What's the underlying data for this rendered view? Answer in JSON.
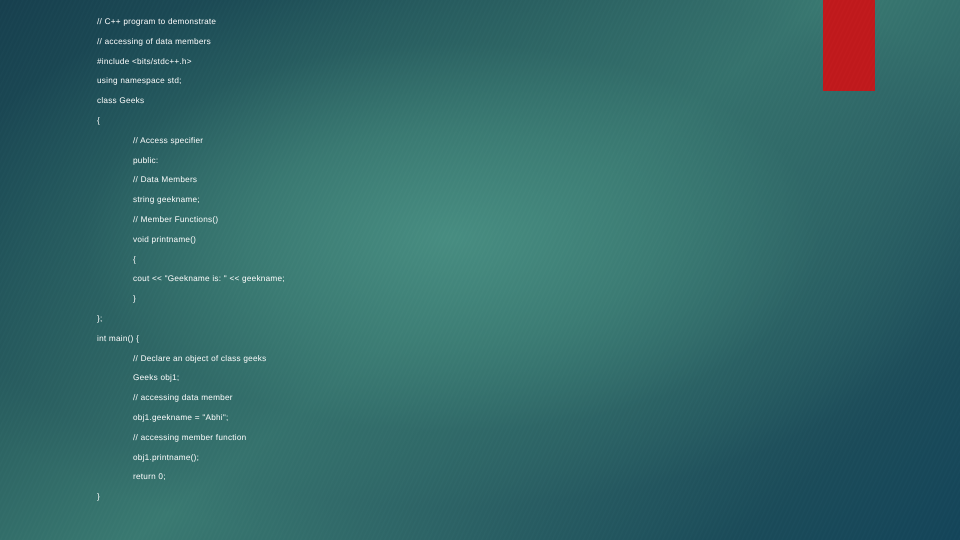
{
  "slide": {
    "background_color_center": "#3d7f75",
    "background_color_top_left": "#1a4050",
    "background_color_bottom_right": "#15455a",
    "text_color": "#fdfdfd"
  },
  "accent_bar": {
    "name": "red-accent-rectangle",
    "color": "#c1191c"
  },
  "code": {
    "language": "C++",
    "lines": [
      {
        "indent": 0,
        "text": "// C++ program to demonstrate"
      },
      {
        "indent": 0,
        "text": "// accessing of data members"
      },
      {
        "indent": 0,
        "text": "#include <bits/stdc++.h>"
      },
      {
        "indent": 0,
        "text": "using namespace std;"
      },
      {
        "indent": 0,
        "text": "class Geeks"
      },
      {
        "indent": 0,
        "text": "{"
      },
      {
        "indent": 1,
        "text": "// Access specifier"
      },
      {
        "indent": 1,
        "text": "public:"
      },
      {
        "indent": 1,
        "text": "// Data Members"
      },
      {
        "indent": 1,
        "text": "string geekname;"
      },
      {
        "indent": 1,
        "text": "// Member Functions()"
      },
      {
        "indent": 1,
        "text": "void printname()"
      },
      {
        "indent": 1,
        "text": "{"
      },
      {
        "indent": 1,
        "text": "cout << \"Geekname is: \" << geekname;"
      },
      {
        "indent": 1,
        "text": "}"
      },
      {
        "indent": 0,
        "text": "};"
      },
      {
        "indent": 0,
        "text": "int main() {"
      },
      {
        "indent": 1,
        "text": "// Declare an object of class geeks"
      },
      {
        "indent": 1,
        "text": "Geeks obj1;"
      },
      {
        "indent": 1,
        "text": "// accessing data member"
      },
      {
        "indent": 1,
        "text": "obj1.geekname = \"Abhi\";"
      },
      {
        "indent": 1,
        "text": "// accessing member function"
      },
      {
        "indent": 1,
        "text": "obj1.printname();"
      },
      {
        "indent": 1,
        "text": "return 0;"
      },
      {
        "indent": 0,
        "text": "}"
      }
    ]
  }
}
